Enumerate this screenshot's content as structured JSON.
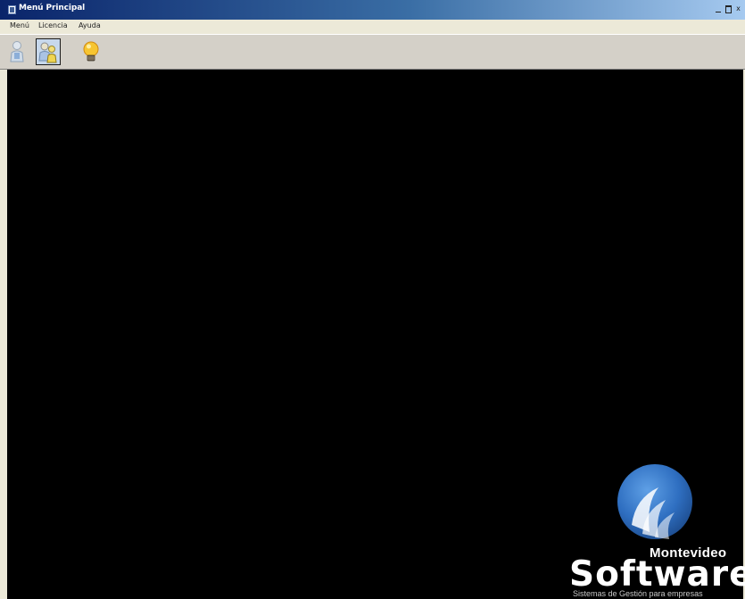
{
  "window": {
    "title": "Menú Principal",
    "controls": {
      "minimize": "_",
      "maximize": "□",
      "close": "x"
    }
  },
  "menubar": {
    "items": [
      {
        "label": "Menú"
      },
      {
        "label": "Licencia"
      },
      {
        "label": "Ayuda"
      }
    ]
  },
  "toolbar": {
    "buttons": [
      {
        "icon": "user-icon"
      },
      {
        "icon": "users-icon",
        "state": "pressed"
      },
      {
        "icon": "lightbulb-icon"
      }
    ]
  },
  "logo": {
    "brand_top": "Montevideo",
    "brand_main": "Software",
    "tagline": "Sistemas de Gestión para empresas",
    "colors": {
      "globe": "#2f6fc1",
      "text": "#ffffff"
    }
  },
  "colors": {
    "titlebar_start": "#0a246a",
    "titlebar_end": "#a6caf0",
    "background": "#000000"
  }
}
